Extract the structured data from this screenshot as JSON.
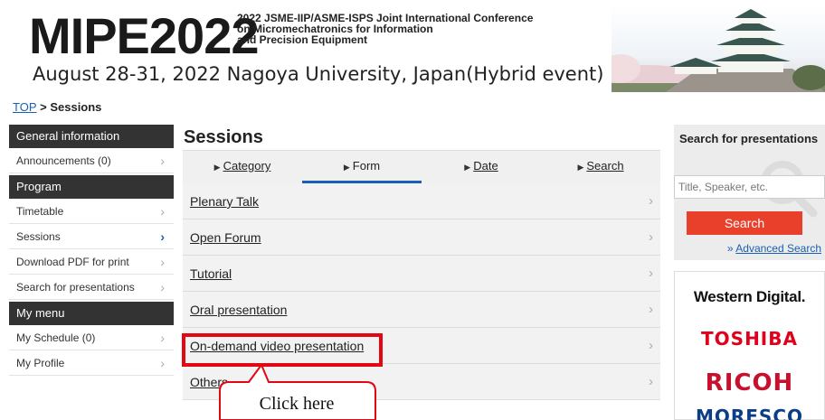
{
  "header": {
    "logo": "MIPE2022",
    "conference_lines": [
      "2022 JSME-IIP/ASME-ISPS Joint International Conference",
      "on Micromechatronics for Information",
      "and Precision Equipment"
    ],
    "date_location": "August 28-31, 2022  Nagoya University, Japan(Hybrid event)"
  },
  "breadcrumb": {
    "top_link": "TOP",
    "separator": " > ",
    "current": "Sessions"
  },
  "sidebar": {
    "sections": [
      {
        "heading": "General information",
        "items": [
          {
            "label": "Announcements (0)"
          }
        ]
      },
      {
        "heading": "Program",
        "items": [
          {
            "label": "Timetable"
          },
          {
            "label": "Sessions",
            "active": true
          },
          {
            "label": "Download PDF for print"
          },
          {
            "label": "Search for presentations"
          }
        ]
      },
      {
        "heading": "My menu",
        "items": [
          {
            "label": "My Schedule (0)"
          },
          {
            "label": "My Profile"
          }
        ]
      }
    ]
  },
  "main": {
    "title": "Sessions",
    "tabs": [
      {
        "label": "Category"
      },
      {
        "label": "Form",
        "active": true
      },
      {
        "label": "Date"
      },
      {
        "label": "Search"
      }
    ],
    "sessions": [
      {
        "label": "Plenary Talk"
      },
      {
        "label": "Open Forum"
      },
      {
        "label": "Tutorial"
      },
      {
        "label": "Oral presentation"
      },
      {
        "label": "On-demand video presentation"
      },
      {
        "label": "Others"
      }
    ]
  },
  "annotation": {
    "callout_text": "Click here",
    "color": "#e30613"
  },
  "search_panel": {
    "title": "Search for presentations",
    "placeholder": "Title, Speaker, etc.",
    "button": "Search",
    "advanced_prefix": "» ",
    "advanced_link": "Advanced Search"
  },
  "sponsors": [
    "Western Digital.",
    "TOSHIBA",
    "RICOH",
    "MORESCO"
  ],
  "colors": {
    "accent": "#1a5fb4",
    "sidebar_heading": "#333333",
    "search_button": "#e8402b"
  }
}
